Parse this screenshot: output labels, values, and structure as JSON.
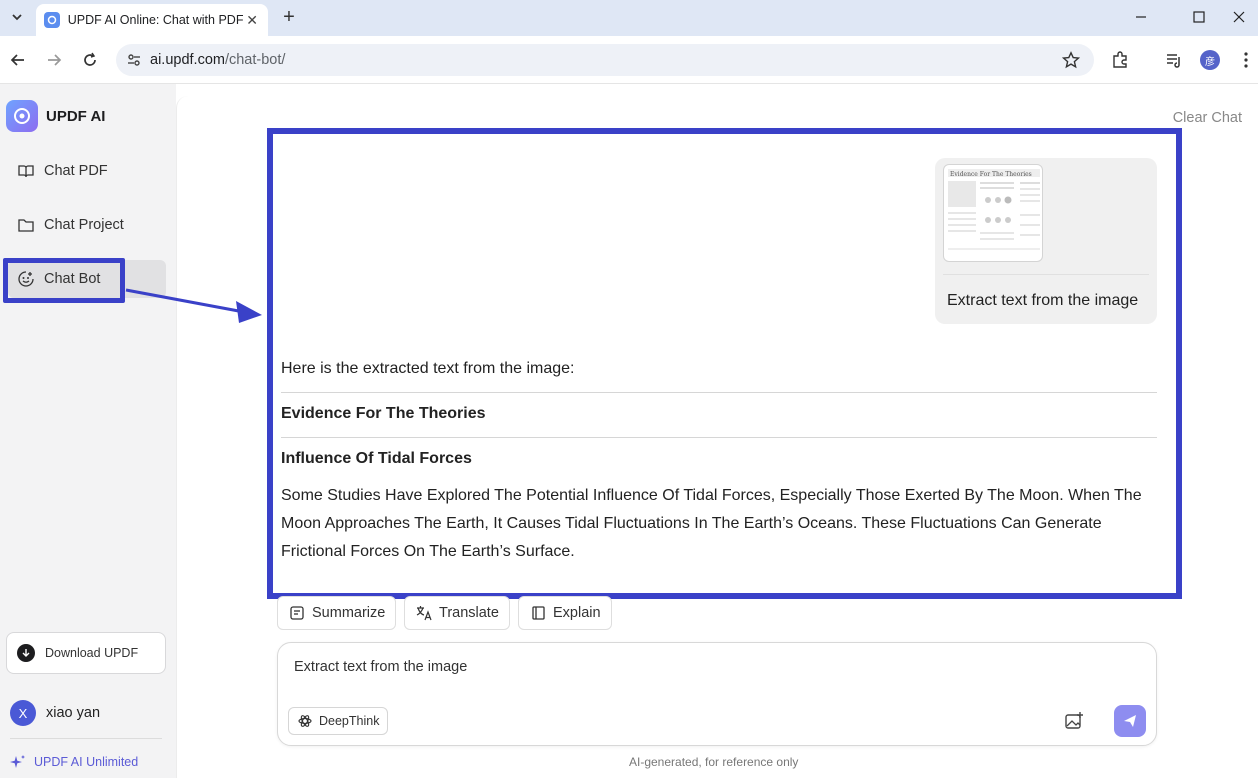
{
  "browser": {
    "tab_title": "UPDF AI Online: Chat with PDF",
    "url_domain": "ai.updf.com",
    "url_path": "/chat-bot/",
    "profile_initial": "彦"
  },
  "sidebar": {
    "brand": "UPDF AI",
    "items": [
      {
        "label": "Chat PDF",
        "icon": "book-open-icon"
      },
      {
        "label": "Chat Project",
        "icon": "folder-icon"
      },
      {
        "label": "Chat Bot",
        "icon": "bot-face-icon",
        "active": true
      }
    ],
    "download_label": "Download UPDF",
    "user_initial": "X",
    "user_name": "xiao yan",
    "unlimited_label": "UPDF AI Unlimited"
  },
  "main": {
    "clear_chat": "Clear Chat",
    "user_message": "Extract text from the image",
    "ai_intro": "Here is the extracted text from the image:",
    "heading_1": "Evidence For The Theories",
    "heading_2": "Influence Of Tidal Forces",
    "paragraph": "Some Studies Have Explored The Potential Influence Of Tidal Forces, Especially Those Exerted By The Moon. When The Moon Approaches The Earth, It Causes Tidal Fluctuations In The Earth’s Oceans. These Fluctuations Can Generate Frictional Forces On The Earth’s Surface.",
    "actions": [
      "Summarize",
      "Translate",
      "Explain"
    ],
    "composer_text": "Extract text from the image",
    "deepthink": "DeepThink",
    "footnote": "AI-generated, for reference only"
  },
  "colors": {
    "highlight": "#3a41c8",
    "accent": "#8e8df0"
  }
}
